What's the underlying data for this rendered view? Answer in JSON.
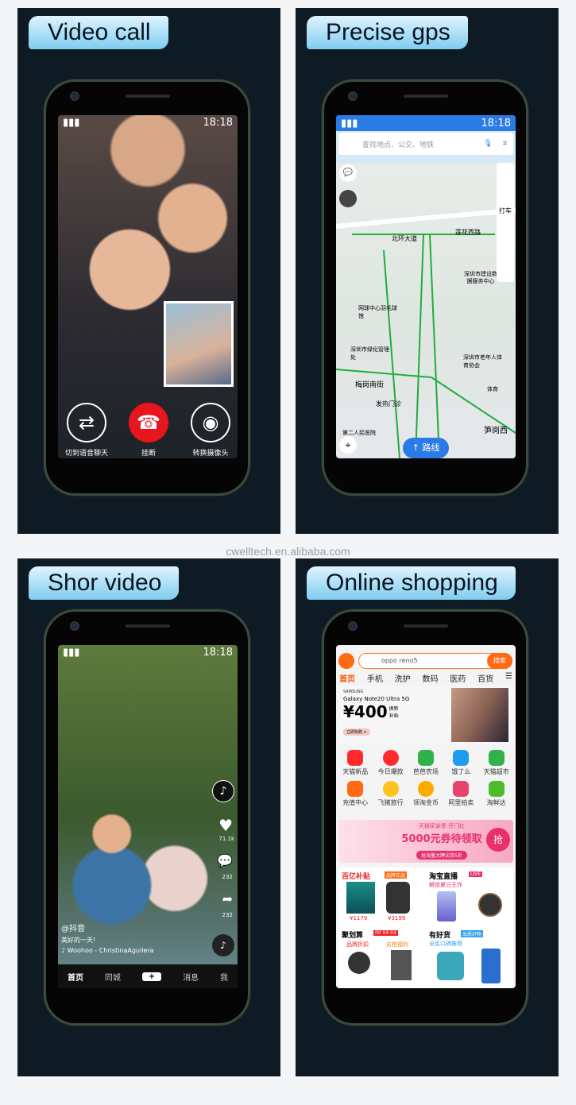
{
  "panels": [
    {
      "title": "Video call",
      "status": {
        "time": "18:18"
      },
      "buttons": [
        {
          "label": "切到语音聊天",
          "icon": "switch-icon"
        },
        {
          "label": "挂断",
          "icon": "hang-up-icon"
        },
        {
          "label": "转换摄像头",
          "icon": "camera-icon"
        }
      ]
    },
    {
      "title": "Precise gps",
      "status": {
        "time": "18:18"
      },
      "search_placeholder": "查找地点、公交、地铁",
      "side_tools": [
        "打车"
      ],
      "map_labels": [
        "北环大道",
        "莲花西路",
        "深圳市建设数据服务中心",
        "网球中心羽毛球馆",
        "深圳市绿化管理处",
        "深圳市老年人体育协会",
        "梅岗南街",
        "发热门诊",
        "第二人民医院",
        "体育",
        "笋岗西"
      ],
      "route_button": "路线"
    },
    {
      "title": "Shor video",
      "status": {
        "time": "18:18"
      },
      "likes": "71.1k",
      "comments": "232",
      "shares": "232",
      "author": "@抖音",
      "caption": "美好的一天!",
      "music": "♪ Woohoo - ChristinaAguilera",
      "nav": [
        "首页",
        "同城",
        "+",
        "消息",
        "我"
      ]
    },
    {
      "title": "Online shopping",
      "search_value": "oppo reno5",
      "search_button": "搜索",
      "tabs": [
        "首页",
        "手机",
        "洗护",
        "数码",
        "医药",
        "百货"
      ],
      "banner": {
        "brand": "SAMSUNG",
        "product": "Galaxy Note20 Ultra 5G",
        "price": "¥400",
        "subsidy": "换新补贴",
        "cta": "立即抢购 >"
      },
      "icons": [
        "天猫新品",
        "今日爆款",
        "芭芭农场",
        "饿了么",
        "天猫超市",
        "充值中心",
        "飞猪旅行",
        "领淘金币",
        "阿里拍卖",
        "淘鲜达"
      ],
      "promo": {
        "top": "天猫家装季 开门红",
        "main": "5000元券待领取",
        "sub": "抢海量大牌尖货5折",
        "button": "抢"
      },
      "sections": [
        {
          "title": "百亿补贴",
          "badge": "品牌正品",
          "prices": [
            "¥1179",
            "¥3199"
          ]
        },
        {
          "title": "淘宝直播",
          "badge": "LIVE",
          "sub": "解锁夏日王炸"
        },
        {
          "title": "聚划算",
          "badge": "00 04 03",
          "sub": [
            "品牌折扣",
            "去抢福利"
          ]
        },
        {
          "title": "有好货",
          "badge": "品质好物",
          "sub": "全民口碑推荐"
        }
      ]
    }
  ],
  "watermark": "cwelltech.en.alibaba.com"
}
